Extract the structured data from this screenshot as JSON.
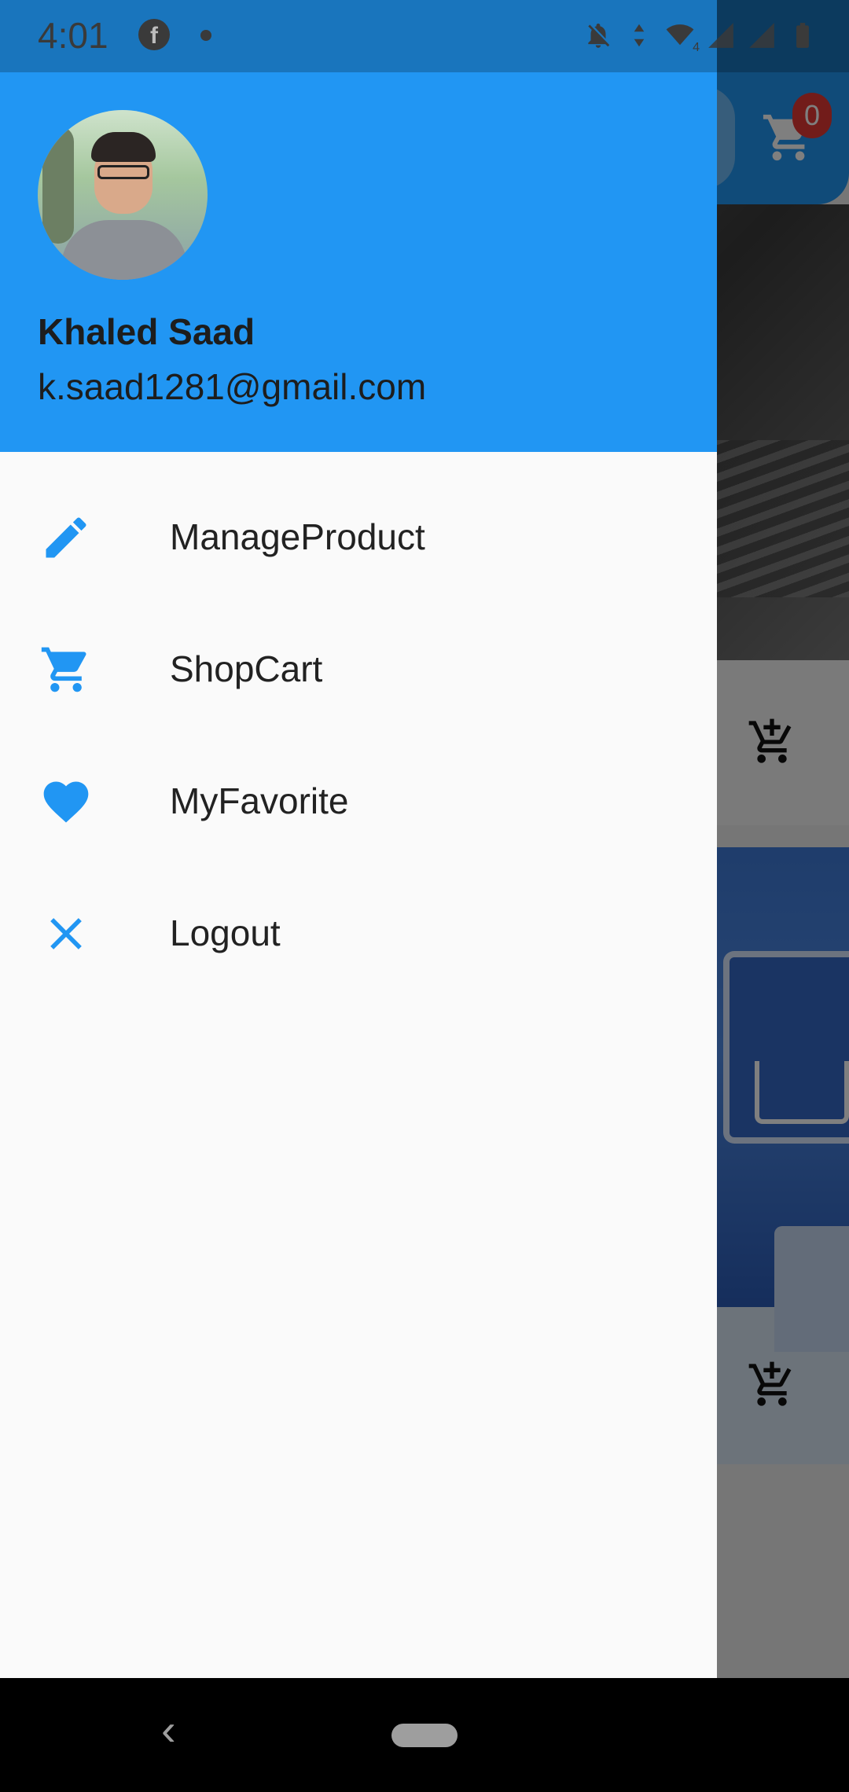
{
  "status_bar": {
    "time": "4:01",
    "fb_glyph": "f",
    "network_label": "4",
    "icons": [
      "facebook-icon",
      "notification-dot",
      "bell-off-icon",
      "data-arrows-icon",
      "wifi-icon",
      "signal-icon",
      "signal-icon",
      "battery-icon"
    ]
  },
  "drawer": {
    "header": {
      "name": "Khaled Saad",
      "email": "k.saad1281@gmail.com",
      "color": "#2196f3"
    },
    "items": [
      {
        "label": "ManageProduct",
        "icon": "pencil-icon"
      },
      {
        "label": "ShopCart",
        "icon": "shopping-cart-icon"
      },
      {
        "label": "MyFavorite",
        "icon": "heart-icon"
      },
      {
        "label": "Logout",
        "icon": "close-icon"
      }
    ],
    "icon_color": "#2196f3"
  },
  "background_app": {
    "cart_badge": "0"
  },
  "nav_bar": {
    "back_glyph": "‹"
  }
}
